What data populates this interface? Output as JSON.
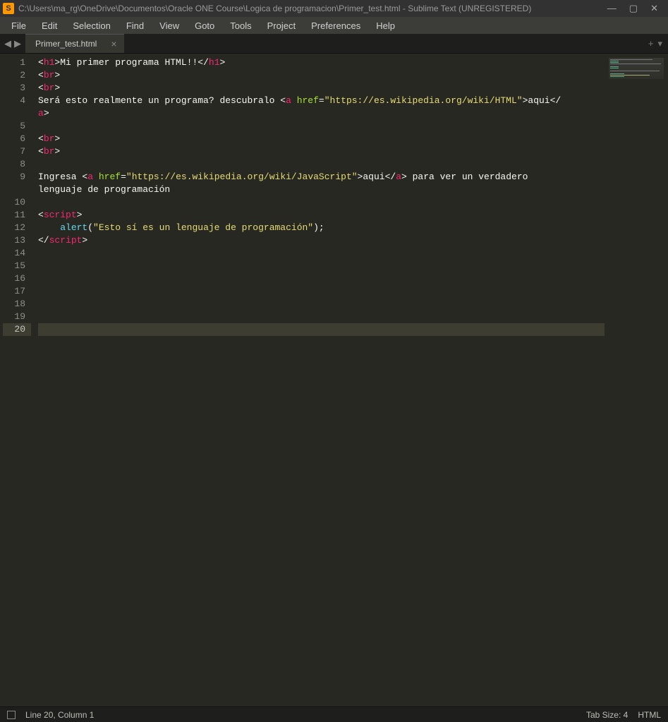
{
  "window": {
    "title": "C:\\Users\\ma_rg\\OneDrive\\Documentos\\Oracle ONE Course\\Logica de programacion\\Primer_test.html - Sublime Text (UNREGISTERED)"
  },
  "menu": {
    "items": [
      "File",
      "Edit",
      "Selection",
      "Find",
      "View",
      "Goto",
      "Tools",
      "Project",
      "Preferences",
      "Help"
    ]
  },
  "tabs": {
    "active": {
      "label": "Primer_test.html"
    }
  },
  "editor": {
    "line_count": 20,
    "current_line": 20,
    "tokens": {
      "l1_h1": "h1",
      "l1_text": "Mi primer programa HTML!!",
      "br": "br",
      "l4_text1": "Será esto realmente un programa? descubralo ",
      "a": "a",
      "href": "href",
      "l4_url": "\"https://es.wikipedia.org/wiki/HTML\"",
      "l4_link": "aqui",
      "l9_text1": "Ingresa ",
      "l9_url": "\"https://es.wikipedia.org/wiki/JavaScript\"",
      "l9_link": "aqui",
      "l9_text2": " para ver un verdadero",
      "l9_wrap": "lenguaje de programación",
      "script": "script",
      "alert": "alert",
      "l12_str": "\"Esto sí es un lenguaje de programación\"",
      "l12_tail": ");"
    }
  },
  "status": {
    "position": "Line 20, Column 1",
    "tabsize": "Tab Size: 4",
    "syntax": "HTML"
  }
}
